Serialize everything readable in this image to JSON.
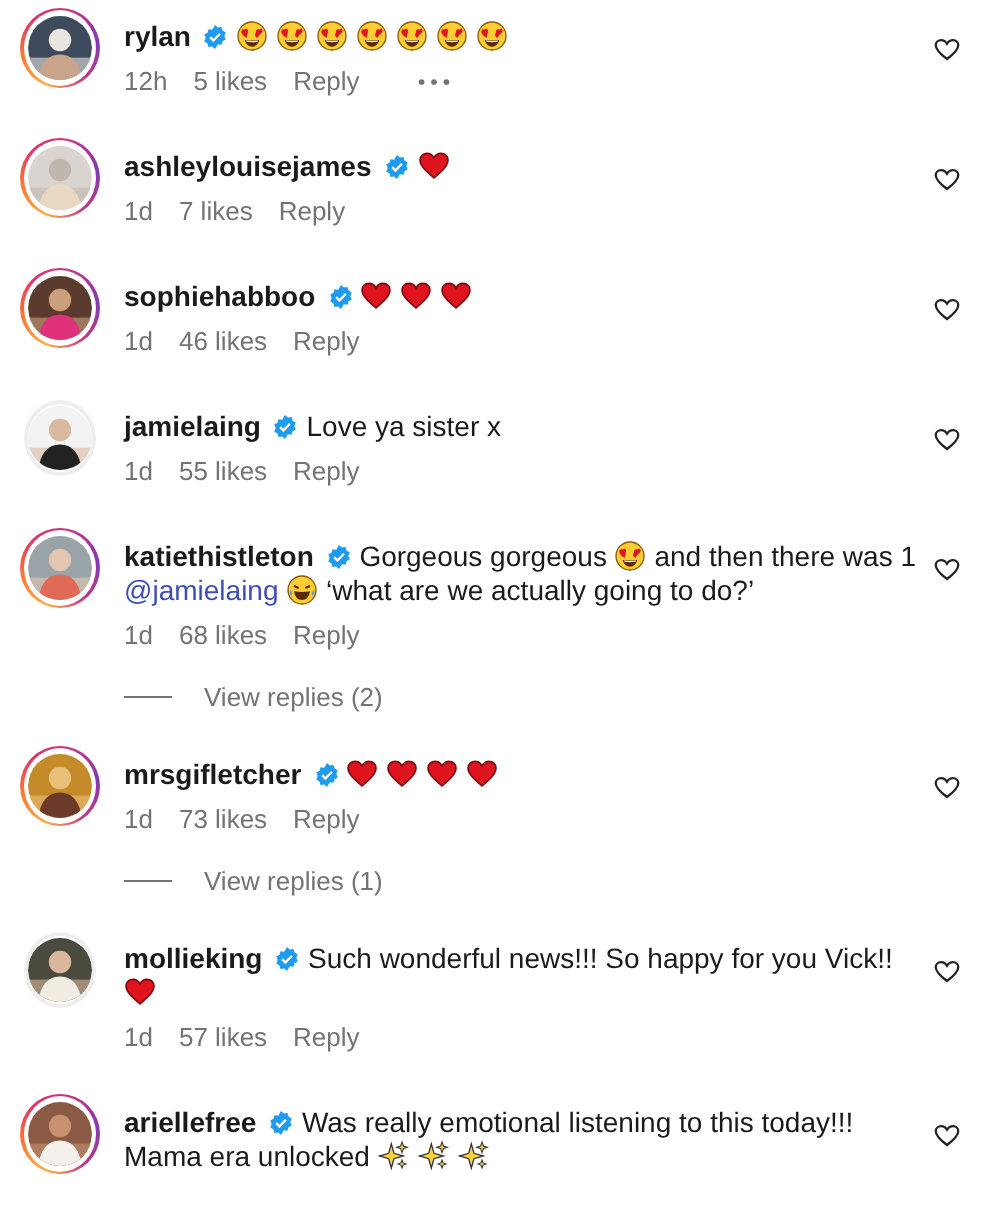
{
  "comments": [
    {
      "username": "rylan",
      "verified": true,
      "story_ring": true,
      "body": [
        {
          "kind": "heart_eyes"
        },
        {
          "kind": "heart_eyes"
        },
        {
          "kind": "heart_eyes"
        },
        {
          "kind": "heart_eyes"
        },
        {
          "kind": "heart_eyes"
        },
        {
          "kind": "heart_eyes"
        },
        {
          "kind": "heart_eyes"
        }
      ],
      "time": "12h",
      "likes": "5 likes",
      "reply": "Reply",
      "more": true,
      "liked": false
    },
    {
      "username": "ashleylouisejames",
      "verified": true,
      "story_ring": true,
      "body": [
        {
          "kind": "heart"
        }
      ],
      "time": "1d",
      "likes": "7 likes",
      "reply": "Reply",
      "more": false,
      "liked": false
    },
    {
      "username": "sophiehabboo",
      "verified": true,
      "story_ring": true,
      "body": [
        {
          "kind": "heart"
        },
        {
          "kind": "heart"
        },
        {
          "kind": "heart"
        }
      ],
      "time": "1d",
      "likes": "46 likes",
      "reply": "Reply",
      "more": false,
      "liked": false
    },
    {
      "username": "jamielaing",
      "verified": true,
      "story_ring": false,
      "body": [
        {
          "kind": "text",
          "text": "Love ya sister x"
        }
      ],
      "time": "1d",
      "likes": "55 likes",
      "reply": "Reply",
      "more": false,
      "liked": false
    },
    {
      "username": "katiethistleton",
      "verified": true,
      "story_ring": true,
      "body": [
        {
          "kind": "text",
          "text": "Gorgeous gorgeous"
        },
        {
          "kind": "heart_eyes"
        },
        {
          "kind": "text",
          "text": "and then there was 1"
        },
        {
          "kind": "mention",
          "text": "@jamielaing"
        },
        {
          "kind": "laughing"
        },
        {
          "kind": "text",
          "text": "‘what are we actually going to do?’"
        }
      ],
      "time": "1d",
      "likes": "68 likes",
      "reply": "Reply",
      "more": false,
      "liked": false,
      "view_replies": "View replies (2)"
    },
    {
      "username": "mrsgifletcher",
      "verified": true,
      "story_ring": true,
      "body": [
        {
          "kind": "heart"
        },
        {
          "kind": "heart"
        },
        {
          "kind": "heart"
        },
        {
          "kind": "heart"
        }
      ],
      "time": "1d",
      "likes": "73 likes",
      "reply": "Reply",
      "more": false,
      "liked": false,
      "view_replies": "View replies (1)"
    },
    {
      "username": "mollieking",
      "verified": true,
      "story_ring": false,
      "body": [
        {
          "kind": "text",
          "text": "Such wonderful news!!! So happy for you Vick!!"
        },
        {
          "kind": "heart"
        }
      ],
      "time": "1d",
      "likes": "57 likes",
      "reply": "Reply",
      "more": false,
      "liked": false
    },
    {
      "username": "ariellefree",
      "verified": true,
      "story_ring": true,
      "body": [
        {
          "kind": "text",
          "text": "Was really emotional listening to this today!!!"
        },
        {
          "kind": "text",
          "text": "Mama era unlocked"
        },
        {
          "kind": "sparkles"
        },
        {
          "kind": "sparkles"
        },
        {
          "kind": "sparkles"
        }
      ],
      "liked": false
    }
  ]
}
